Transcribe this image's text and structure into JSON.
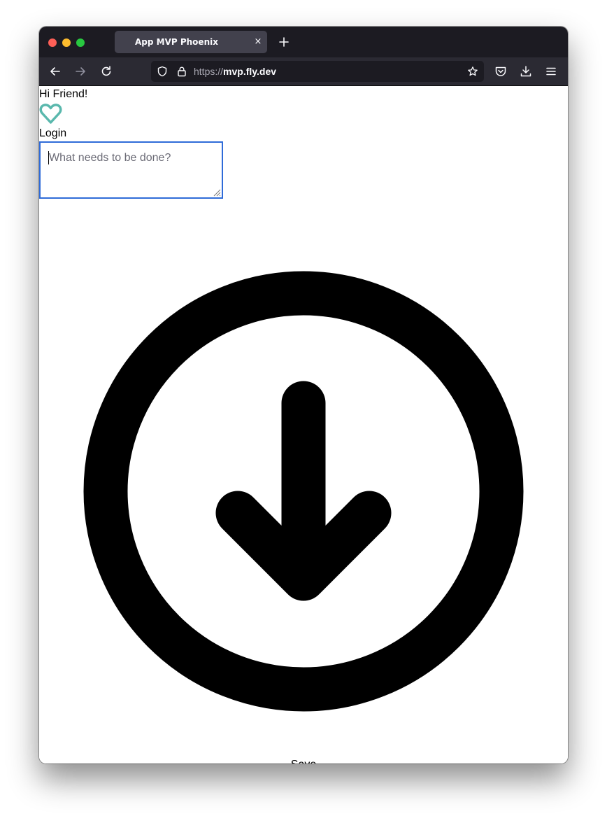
{
  "browser": {
    "tab_title": "App MVP Phoenix",
    "tab_close": "×",
    "url_scheme": "https://",
    "url_host": "mvp.fly.dev"
  },
  "page": {
    "greeting": "Hi Friend!",
    "login_label": "Login",
    "todo_placeholder": "What needs to be done?",
    "save_label": "Save"
  },
  "icons": {
    "logo": "heart-icon",
    "main": "download-circle-icon"
  },
  "colors": {
    "heart": "#5ab8ad",
    "input_focus_border": "#2f6bd8",
    "icon": "#000000"
  }
}
